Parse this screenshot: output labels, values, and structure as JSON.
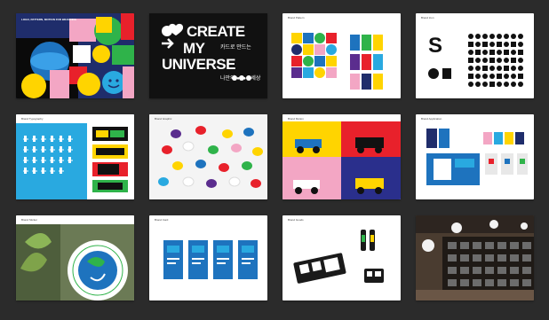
{
  "board": {
    "tiles": [
      {
        "id": "tile-1",
        "caption": "LOGO, PATTERN, MOTION FOR BRANDING",
        "page": ""
      },
      {
        "id": "tile-2",
        "caption": "",
        "headline_1": "CREATE",
        "headline_2": "MY",
        "headline_3": "UNIVERSE",
        "korean_1": "카드로 만드는",
        "korean_2": "나만의 ●●●● 세상",
        "page": ""
      },
      {
        "id": "tile-3",
        "caption": "Brand Pattern",
        "page": ""
      },
      {
        "id": "tile-4",
        "caption": "Brand Icon",
        "letter": "S",
        "page": ""
      },
      {
        "id": "tile-5",
        "caption": "Brand Typography",
        "page": ""
      },
      {
        "id": "tile-6",
        "caption": "Brand Graphic",
        "page": ""
      },
      {
        "id": "tile-7",
        "caption": "Brand Motion",
        "page": ""
      },
      {
        "id": "tile-8",
        "caption": "Brand Application",
        "page": ""
      },
      {
        "id": "tile-9",
        "caption": "Brand Sticker",
        "sticker_text": "SAVE THE EARTH FOR US",
        "page": ""
      },
      {
        "id": "tile-10",
        "caption": "Brand Card",
        "page": ""
      },
      {
        "id": "tile-11",
        "caption": "Brand Goods",
        "page": ""
      },
      {
        "id": "tile-12",
        "caption": "",
        "page": ""
      }
    ]
  },
  "colors": {
    "background": "#2b2b2b",
    "navy": "#1f2d6b",
    "blue": "#1e73be",
    "sky": "#29a9e0",
    "yellow": "#ffd400",
    "red": "#e8212b",
    "green": "#2fb34a",
    "pink": "#f3a6c4",
    "purple": "#5b2d8e"
  }
}
